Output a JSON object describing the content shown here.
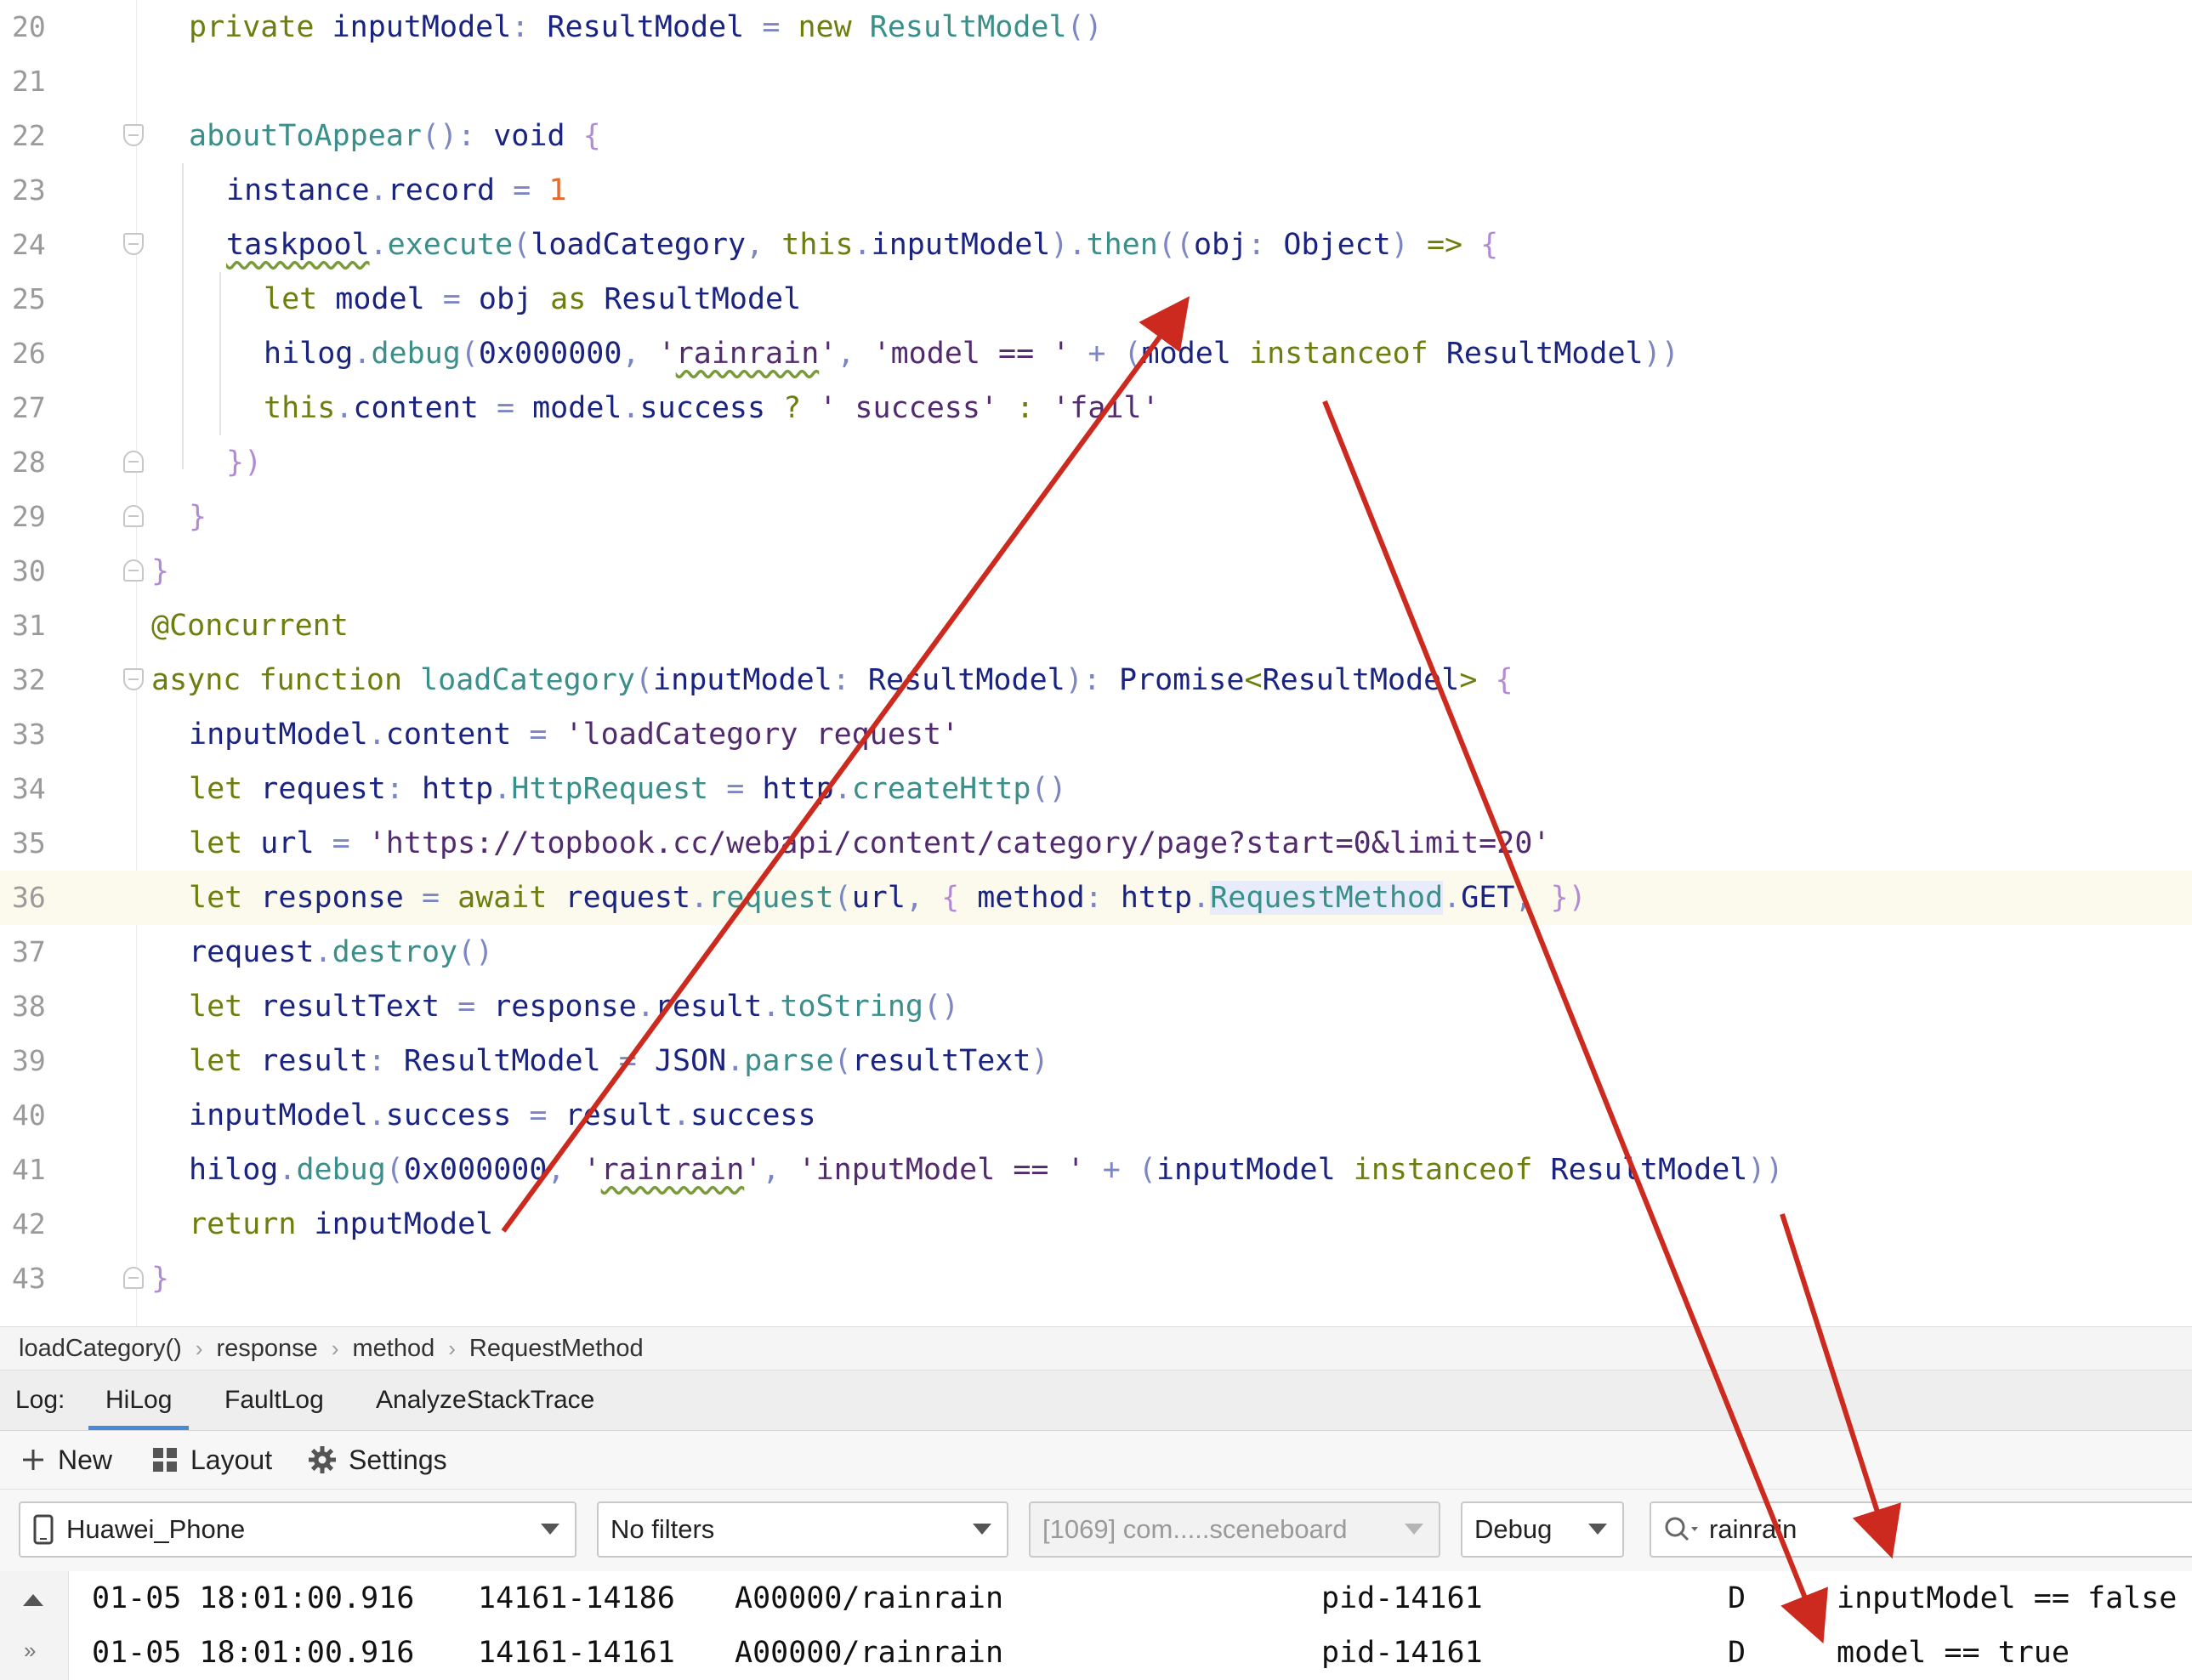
{
  "editor": {
    "lines": [
      {
        "n": "20",
        "tokens": [
          {
            "t": "private ",
            "c": "kw"
          },
          {
            "t": "inputModel",
            "c": "plain"
          },
          {
            "t": ": ",
            "c": "pun"
          },
          {
            "t": "ResultModel",
            "c": "type"
          },
          {
            "t": " = ",
            "c": "pun"
          },
          {
            "t": "new ",
            "c": "kw"
          },
          {
            "t": "ResultModel",
            "c": "fn"
          },
          {
            "t": "()",
            "c": "pun"
          }
        ]
      },
      {
        "n": "21",
        "tokens": []
      },
      {
        "n": "22",
        "tokens": [
          {
            "t": "aboutToAppear",
            "c": "fn"
          },
          {
            "t": "(): ",
            "c": "pun"
          },
          {
            "t": "void ",
            "c": "type"
          },
          {
            "t": "{",
            "c": "brace"
          }
        ]
      },
      {
        "n": "23",
        "tokens": [
          {
            "t": "instance",
            "c": "plain"
          },
          {
            "t": ".",
            "c": "pun"
          },
          {
            "t": "record",
            "c": "plain"
          },
          {
            "t": " = ",
            "c": "pun"
          },
          {
            "t": "1",
            "c": "num"
          }
        ]
      },
      {
        "n": "24",
        "tokens": [
          {
            "t": "taskpool",
            "c": "plain squig"
          },
          {
            "t": ".",
            "c": "pun"
          },
          {
            "t": "execute",
            "c": "fn"
          },
          {
            "t": "(",
            "c": "pun"
          },
          {
            "t": "loadCategory",
            "c": "plain"
          },
          {
            "t": ", ",
            "c": "pun"
          },
          {
            "t": "this",
            "c": "kw"
          },
          {
            "t": ".",
            "c": "pun"
          },
          {
            "t": "inputModel",
            "c": "plain"
          },
          {
            "t": ").",
            "c": "pun"
          },
          {
            "t": "then",
            "c": "fn"
          },
          {
            "t": "((",
            "c": "pun"
          },
          {
            "t": "obj",
            "c": "plain"
          },
          {
            "t": ": ",
            "c": "pun"
          },
          {
            "t": "Object",
            "c": "type"
          },
          {
            "t": ") ",
            "c": "pun"
          },
          {
            "t": "=> ",
            "c": "kw"
          },
          {
            "t": "{",
            "c": "brace"
          }
        ]
      },
      {
        "n": "25",
        "tokens": [
          {
            "t": "let ",
            "c": "kw"
          },
          {
            "t": "model",
            "c": "plain"
          },
          {
            "t": " = ",
            "c": "pun"
          },
          {
            "t": "obj ",
            "c": "plain"
          },
          {
            "t": "as ",
            "c": "kw"
          },
          {
            "t": "ResultModel",
            "c": "type"
          }
        ]
      },
      {
        "n": "26",
        "tokens": [
          {
            "t": "hilog",
            "c": "plain"
          },
          {
            "t": ".",
            "c": "pun"
          },
          {
            "t": "debug",
            "c": "fn"
          },
          {
            "t": "(",
            "c": "pun"
          },
          {
            "t": "0x000000",
            "c": "plain"
          },
          {
            "t": ", ",
            "c": "pun"
          },
          {
            "t": "'",
            "c": "str"
          },
          {
            "t": "rainrain",
            "c": "str squig"
          },
          {
            "t": "'",
            "c": "str"
          },
          {
            "t": ", ",
            "c": "pun"
          },
          {
            "t": "'model == '",
            "c": "str"
          },
          {
            "t": " + ",
            "c": "pun"
          },
          {
            "t": "(",
            "c": "pun"
          },
          {
            "t": "model ",
            "c": "plain"
          },
          {
            "t": "instanceof ",
            "c": "kw"
          },
          {
            "t": "ResultModel",
            "c": "type"
          },
          {
            "t": "))",
            "c": "pun"
          }
        ]
      },
      {
        "n": "27",
        "tokens": [
          {
            "t": "this",
            "c": "kw"
          },
          {
            "t": ".",
            "c": "pun"
          },
          {
            "t": "content",
            "c": "plain"
          },
          {
            "t": " = ",
            "c": "pun"
          },
          {
            "t": "model",
            "c": "plain"
          },
          {
            "t": ".",
            "c": "pun"
          },
          {
            "t": "success",
            "c": "plain"
          },
          {
            "t": " ? ",
            "c": "kw"
          },
          {
            "t": "' success'",
            "c": "str"
          },
          {
            "t": " : ",
            "c": "kw"
          },
          {
            "t": "'fail'",
            "c": "str"
          }
        ]
      },
      {
        "n": "28",
        "tokens": [
          {
            "t": "})",
            "c": "brace"
          }
        ]
      },
      {
        "n": "29",
        "tokens": [
          {
            "t": "}",
            "c": "brace"
          }
        ]
      },
      {
        "n": "30",
        "tokens": [
          {
            "t": "}",
            "c": "brace"
          }
        ]
      },
      {
        "n": "31",
        "tokens": [
          {
            "t": "@Concurrent",
            "c": "ann"
          }
        ]
      },
      {
        "n": "32",
        "tokens": [
          {
            "t": "async ",
            "c": "kw"
          },
          {
            "t": "function ",
            "c": "kw"
          },
          {
            "t": "loadCategory",
            "c": "fn"
          },
          {
            "t": "(",
            "c": "pun"
          },
          {
            "t": "inputModel",
            "c": "plain"
          },
          {
            "t": ": ",
            "c": "pun"
          },
          {
            "t": "ResultModel",
            "c": "type"
          },
          {
            "t": "): ",
            "c": "pun"
          },
          {
            "t": "Promise",
            "c": "type"
          },
          {
            "t": "<",
            "c": "kw"
          },
          {
            "t": "ResultModel",
            "c": "type"
          },
          {
            "t": "> ",
            "c": "kw"
          },
          {
            "t": "{",
            "c": "brace"
          }
        ]
      },
      {
        "n": "33",
        "tokens": [
          {
            "t": "inputModel",
            "c": "plain"
          },
          {
            "t": ".",
            "c": "pun"
          },
          {
            "t": "content",
            "c": "plain"
          },
          {
            "t": " = ",
            "c": "pun"
          },
          {
            "t": "'loadCategory request'",
            "c": "str"
          }
        ]
      },
      {
        "n": "34",
        "tokens": [
          {
            "t": "let ",
            "c": "kw"
          },
          {
            "t": "request",
            "c": "plain"
          },
          {
            "t": ": ",
            "c": "pun"
          },
          {
            "t": "http",
            "c": "plain"
          },
          {
            "t": ".",
            "c": "pun"
          },
          {
            "t": "HttpRequest",
            "c": "fn"
          },
          {
            "t": " = ",
            "c": "pun"
          },
          {
            "t": "http",
            "c": "plain"
          },
          {
            "t": ".",
            "c": "pun"
          },
          {
            "t": "createHttp",
            "c": "fn"
          },
          {
            "t": "()",
            "c": "pun"
          }
        ]
      },
      {
        "n": "35",
        "tokens": [
          {
            "t": "let ",
            "c": "kw"
          },
          {
            "t": "url",
            "c": "plain"
          },
          {
            "t": " = ",
            "c": "pun"
          },
          {
            "t": "'https://topbook.cc/webapi/content/category/page?start=0&limit=20'",
            "c": "str"
          }
        ]
      },
      {
        "n": "36",
        "tokens": [
          {
            "t": "let ",
            "c": "kw"
          },
          {
            "t": "response",
            "c": "plain"
          },
          {
            "t": " = ",
            "c": "pun"
          },
          {
            "t": "await ",
            "c": "kw"
          },
          {
            "t": "request",
            "c": "plain"
          },
          {
            "t": ".",
            "c": "pun"
          },
          {
            "t": "request",
            "c": "fn"
          },
          {
            "t": "(",
            "c": "pun"
          },
          {
            "t": "url",
            "c": "plain"
          },
          {
            "t": ", ",
            "c": "pun"
          },
          {
            "t": "{ ",
            "c": "brace"
          },
          {
            "t": "method",
            "c": "plain"
          },
          {
            "t": ": ",
            "c": "pun"
          },
          {
            "t": "http",
            "c": "plain"
          },
          {
            "t": ".",
            "c": "pun"
          },
          {
            "t": "RequestMethod",
            "c": "fn hlword"
          },
          {
            "t": ".",
            "c": "pun"
          },
          {
            "t": "GET",
            "c": "plain"
          },
          {
            "t": ", ",
            "c": "pun"
          },
          {
            "t": "})",
            "c": "brace"
          }
        ]
      },
      {
        "n": "37",
        "tokens": [
          {
            "t": "request",
            "c": "plain"
          },
          {
            "t": ".",
            "c": "pun"
          },
          {
            "t": "destroy",
            "c": "fn"
          },
          {
            "t": "()",
            "c": "pun"
          }
        ]
      },
      {
        "n": "38",
        "tokens": [
          {
            "t": "let ",
            "c": "kw"
          },
          {
            "t": "resultText",
            "c": "plain"
          },
          {
            "t": " = ",
            "c": "pun"
          },
          {
            "t": "response",
            "c": "plain"
          },
          {
            "t": ".",
            "c": "pun"
          },
          {
            "t": "result",
            "c": "plain"
          },
          {
            "t": ".",
            "c": "pun"
          },
          {
            "t": "toString",
            "c": "fn"
          },
          {
            "t": "()",
            "c": "pun"
          }
        ]
      },
      {
        "n": "39",
        "tokens": [
          {
            "t": "let ",
            "c": "kw"
          },
          {
            "t": "result",
            "c": "plain"
          },
          {
            "t": ": ",
            "c": "pun"
          },
          {
            "t": "ResultModel",
            "c": "type"
          },
          {
            "t": " = ",
            "c": "pun"
          },
          {
            "t": "JSON",
            "c": "plain"
          },
          {
            "t": ".",
            "c": "pun"
          },
          {
            "t": "parse",
            "c": "fn"
          },
          {
            "t": "(",
            "c": "pun"
          },
          {
            "t": "resultText",
            "c": "plain"
          },
          {
            "t": ")",
            "c": "pun"
          }
        ]
      },
      {
        "n": "40",
        "tokens": [
          {
            "t": "inputModel",
            "c": "plain"
          },
          {
            "t": ".",
            "c": "pun"
          },
          {
            "t": "success",
            "c": "plain"
          },
          {
            "t": " = ",
            "c": "pun"
          },
          {
            "t": "result",
            "c": "plain"
          },
          {
            "t": ".",
            "c": "pun"
          },
          {
            "t": "success",
            "c": "plain"
          }
        ]
      },
      {
        "n": "41",
        "tokens": [
          {
            "t": "hilog",
            "c": "plain"
          },
          {
            "t": ".",
            "c": "pun"
          },
          {
            "t": "debug",
            "c": "fn"
          },
          {
            "t": "(",
            "c": "pun"
          },
          {
            "t": "0x000000",
            "c": "plain"
          },
          {
            "t": ", ",
            "c": "pun"
          },
          {
            "t": "'",
            "c": "str"
          },
          {
            "t": "rainrain",
            "c": "str squig"
          },
          {
            "t": "'",
            "c": "str"
          },
          {
            "t": ", ",
            "c": "pun"
          },
          {
            "t": "'inputModel == '",
            "c": "str"
          },
          {
            "t": " + ",
            "c": "pun"
          },
          {
            "t": "(",
            "c": "pun"
          },
          {
            "t": "inputModel ",
            "c": "plain"
          },
          {
            "t": "instanceof ",
            "c": "kw"
          },
          {
            "t": "ResultModel",
            "c": "type"
          },
          {
            "t": "))",
            "c": "pun"
          }
        ]
      },
      {
        "n": "42",
        "tokens": [
          {
            "t": "return ",
            "c": "kw"
          },
          {
            "t": "inputModel",
            "c": "plain"
          }
        ]
      },
      {
        "n": "43",
        "tokens": [
          {
            "t": "}",
            "c": "brace"
          }
        ]
      }
    ]
  },
  "breadcrumb": [
    "loadCategory()",
    "response",
    "method",
    "RequestMethod"
  ],
  "log": {
    "label": "Log:",
    "tabs": [
      "HiLog",
      "FaultLog",
      "AnalyzeStackTrace"
    ],
    "toolbar": {
      "new": "New",
      "layout": "Layout",
      "settings": "Settings"
    },
    "filters": {
      "device": "Huawei_Phone",
      "filter": "No filters",
      "process": "[1069] com.....sceneboard",
      "level": "Debug",
      "search": "rainrain"
    },
    "rows": [
      {
        "time": "01-05 18:01:00.916",
        "pid_tid": "14161-14186",
        "tag": "A00000/rainrain",
        "pid": "pid-14161",
        "level": "D",
        "msg": "inputModel == false"
      },
      {
        "time": "01-05 18:01:00.916",
        "pid_tid": "14161-14161",
        "tag": "A00000/rainrain",
        "pid": "pid-14161",
        "level": "D",
        "msg": "model == true"
      }
    ]
  },
  "colors": {
    "annotation_arrow": "#cc2a1e",
    "accent": "#4a88d8"
  }
}
